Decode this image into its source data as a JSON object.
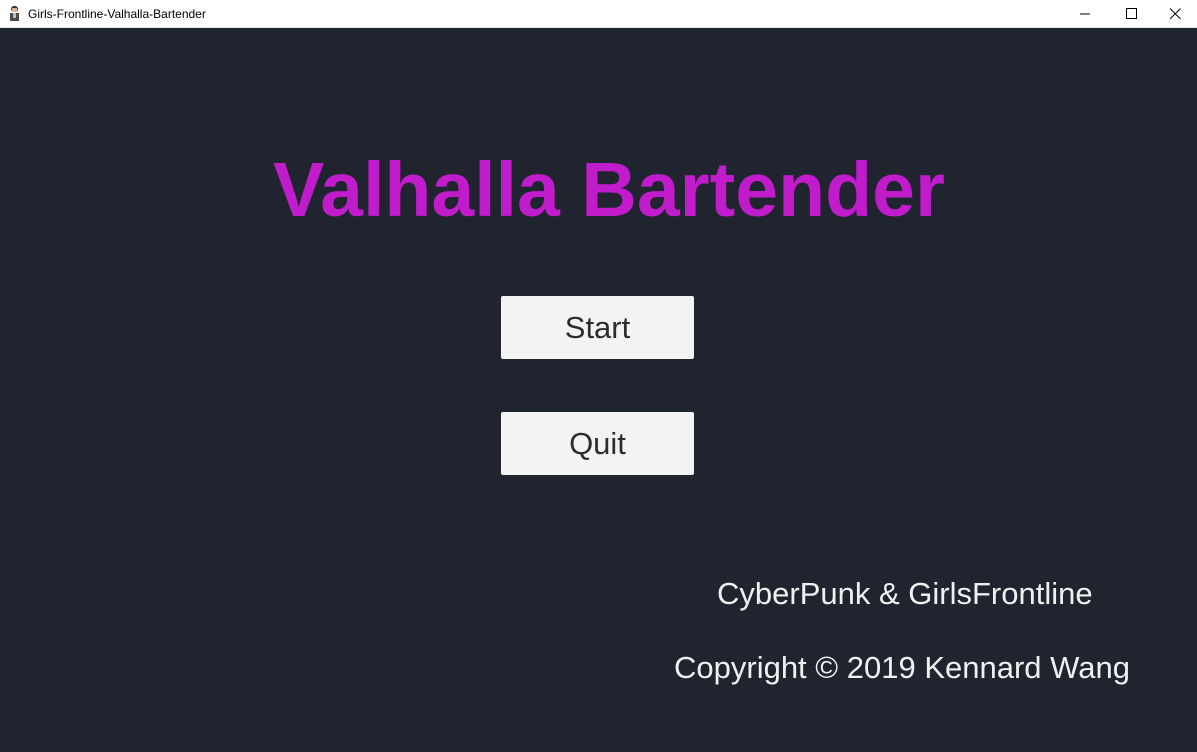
{
  "window": {
    "title": "Girls-Frontline-Valhalla-Bartender",
    "app_icon": "character-portrait-icon",
    "controls": {
      "minimize_icon": "minimize-icon",
      "maximize_icon": "maximize-icon",
      "close_icon": "close-icon"
    }
  },
  "main_menu": {
    "title": "Valhalla Bartender",
    "buttons": {
      "start_label": "Start",
      "quit_label": "Quit"
    },
    "credits": {
      "line1": "CyberPunk & GirlsFrontline",
      "line2": "Copyright © 2019 Kennard Wang"
    }
  },
  "colors": {
    "background": "#20242f",
    "title": "#c01ccc",
    "button_bg": "#f3f3f3",
    "button_text": "#2d2d2d",
    "credit_text": "#f0f0f0"
  }
}
